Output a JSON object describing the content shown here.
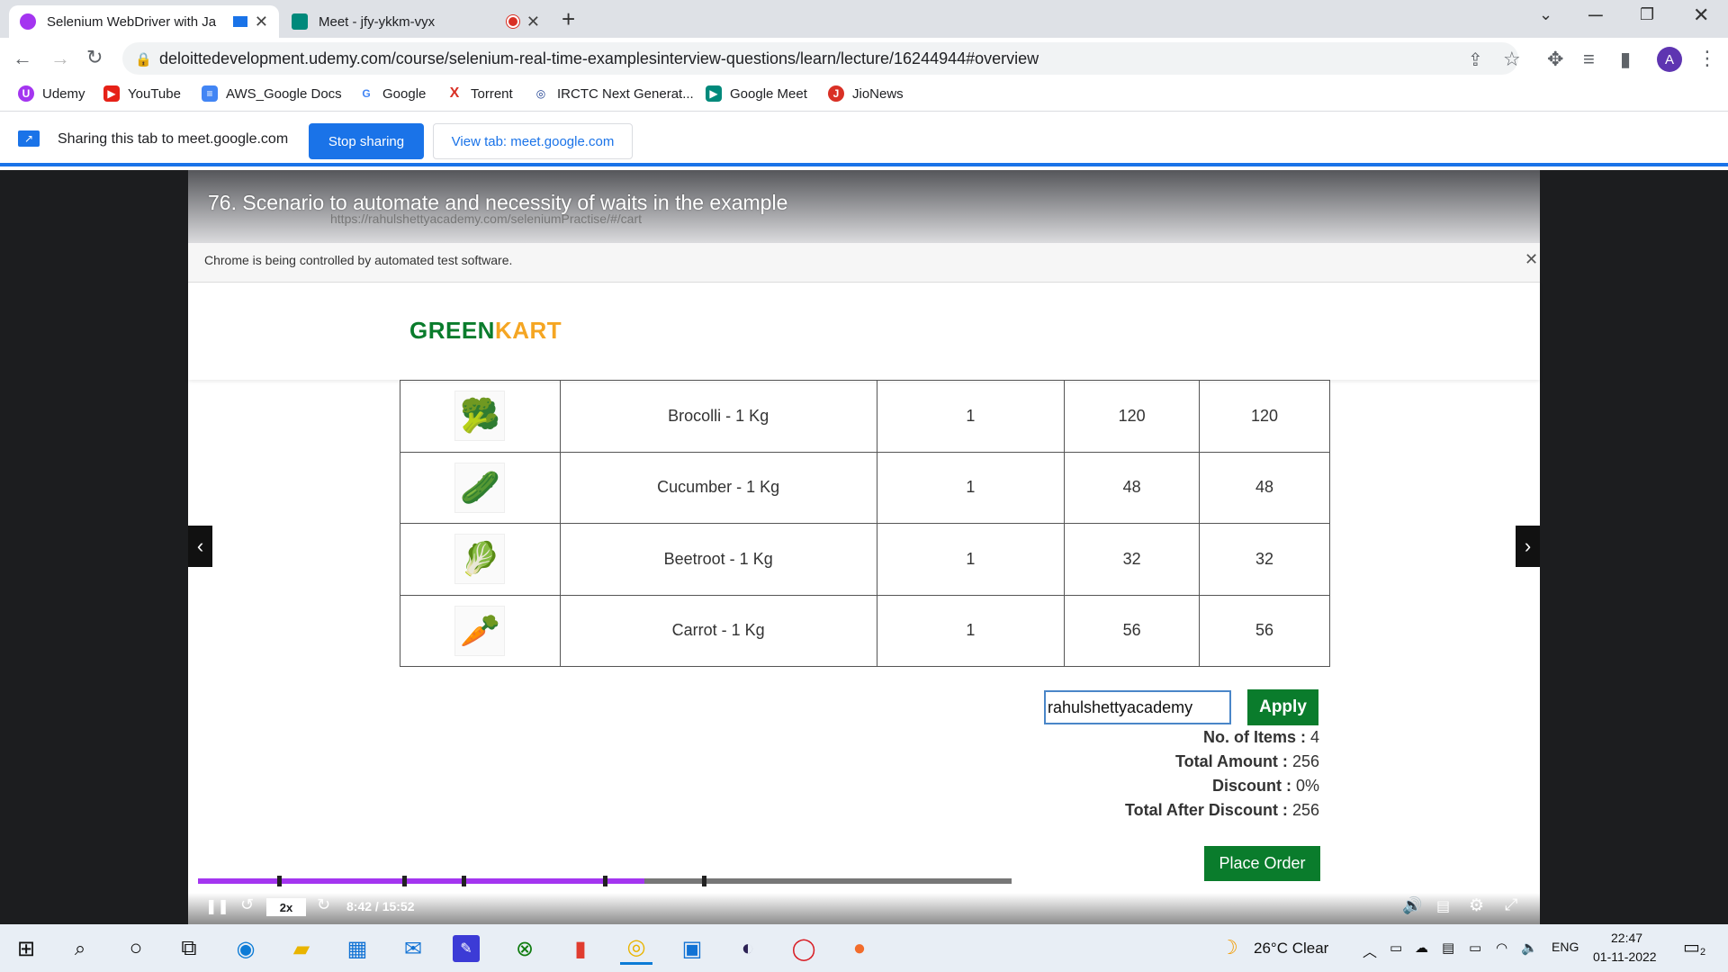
{
  "browser": {
    "tabs": [
      {
        "title": "Selenium WebDriver with Ja",
        "active": true
      },
      {
        "title": "Meet - jfy-ykkm-vyx",
        "active": false
      }
    ],
    "url": "deloittedevelopment.udemy.com/course/selenium-real-time-examplesinterview-questions/learn/lecture/16244944#overview",
    "profile_initial": "A",
    "bookmarks": [
      "Udemy",
      "YouTube",
      "AWS_Google Docs",
      "Google",
      "Torrent",
      "IRCTC Next Generat...",
      "Google Meet",
      "JioNews"
    ]
  },
  "sharing_bar": {
    "message": "Sharing this tab to meet.google.com",
    "stop_label": "Stop sharing",
    "view_label": "View tab: meet.google.com"
  },
  "lecture": {
    "title": "76. Scenario to automate and necessity of waits in the example",
    "inner_url": "https://rahulshettyacademy.com/seleniumPractise/#/cart",
    "automation_notice": "Chrome is being controlled by automated test software.",
    "logo_green": "GREEN",
    "logo_kart": "KART"
  },
  "cart": {
    "rows": [
      {
        "img": "🥦",
        "name": "Brocolli - 1 Kg",
        "qty": "1",
        "price": "120",
        "total": "120"
      },
      {
        "img": "🥒",
        "name": "Cucumber - 1 Kg",
        "qty": "1",
        "price": "48",
        "total": "48"
      },
      {
        "img": "🥬",
        "name": "Beetroot - 1 Kg",
        "qty": "1",
        "price": "32",
        "total": "32"
      },
      {
        "img": "🥕",
        "name": "Carrot - 1 Kg",
        "qty": "1",
        "price": "56",
        "total": "56"
      }
    ],
    "promo_value": "rahulshettyacademy",
    "apply_label": "Apply",
    "items_label": "No. of Items :",
    "items_value": "4",
    "amount_label": "Total Amount :",
    "amount_value": "256",
    "discount_label": "Discount :",
    "discount_value": "0%",
    "after_label": "Total After Discount :",
    "after_value": "256",
    "place_order_label": "Place Order"
  },
  "player": {
    "speed": "2x",
    "timecode": "8:42 / 15:52",
    "progress_fraction": 0.549,
    "accent": "#a435f0"
  },
  "taskbar": {
    "weather": "26°C  Clear",
    "language": "ENG",
    "time": "22:47",
    "date": "01-11-2022",
    "notifications": "2"
  }
}
